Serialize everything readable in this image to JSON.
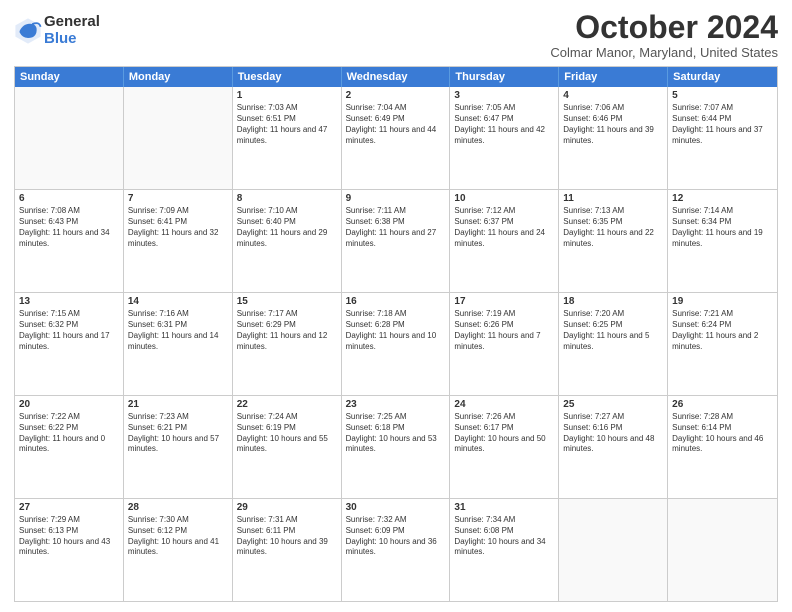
{
  "logo": {
    "general": "General",
    "blue": "Blue"
  },
  "title": "October 2024",
  "location": "Colmar Manor, Maryland, United States",
  "header_days": [
    "Sunday",
    "Monday",
    "Tuesday",
    "Wednesday",
    "Thursday",
    "Friday",
    "Saturday"
  ],
  "rows": [
    [
      {
        "day": "",
        "empty": true,
        "sunrise": "",
        "sunset": "",
        "daylight": ""
      },
      {
        "day": "",
        "empty": true,
        "sunrise": "",
        "sunset": "",
        "daylight": ""
      },
      {
        "day": "1",
        "empty": false,
        "sunrise": "Sunrise: 7:03 AM",
        "sunset": "Sunset: 6:51 PM",
        "daylight": "Daylight: 11 hours and 47 minutes."
      },
      {
        "day": "2",
        "empty": false,
        "sunrise": "Sunrise: 7:04 AM",
        "sunset": "Sunset: 6:49 PM",
        "daylight": "Daylight: 11 hours and 44 minutes."
      },
      {
        "day": "3",
        "empty": false,
        "sunrise": "Sunrise: 7:05 AM",
        "sunset": "Sunset: 6:47 PM",
        "daylight": "Daylight: 11 hours and 42 minutes."
      },
      {
        "day": "4",
        "empty": false,
        "sunrise": "Sunrise: 7:06 AM",
        "sunset": "Sunset: 6:46 PM",
        "daylight": "Daylight: 11 hours and 39 minutes."
      },
      {
        "day": "5",
        "empty": false,
        "sunrise": "Sunrise: 7:07 AM",
        "sunset": "Sunset: 6:44 PM",
        "daylight": "Daylight: 11 hours and 37 minutes."
      }
    ],
    [
      {
        "day": "6",
        "empty": false,
        "sunrise": "Sunrise: 7:08 AM",
        "sunset": "Sunset: 6:43 PM",
        "daylight": "Daylight: 11 hours and 34 minutes."
      },
      {
        "day": "7",
        "empty": false,
        "sunrise": "Sunrise: 7:09 AM",
        "sunset": "Sunset: 6:41 PM",
        "daylight": "Daylight: 11 hours and 32 minutes."
      },
      {
        "day": "8",
        "empty": false,
        "sunrise": "Sunrise: 7:10 AM",
        "sunset": "Sunset: 6:40 PM",
        "daylight": "Daylight: 11 hours and 29 minutes."
      },
      {
        "day": "9",
        "empty": false,
        "sunrise": "Sunrise: 7:11 AM",
        "sunset": "Sunset: 6:38 PM",
        "daylight": "Daylight: 11 hours and 27 minutes."
      },
      {
        "day": "10",
        "empty": false,
        "sunrise": "Sunrise: 7:12 AM",
        "sunset": "Sunset: 6:37 PM",
        "daylight": "Daylight: 11 hours and 24 minutes."
      },
      {
        "day": "11",
        "empty": false,
        "sunrise": "Sunrise: 7:13 AM",
        "sunset": "Sunset: 6:35 PM",
        "daylight": "Daylight: 11 hours and 22 minutes."
      },
      {
        "day": "12",
        "empty": false,
        "sunrise": "Sunrise: 7:14 AM",
        "sunset": "Sunset: 6:34 PM",
        "daylight": "Daylight: 11 hours and 19 minutes."
      }
    ],
    [
      {
        "day": "13",
        "empty": false,
        "sunrise": "Sunrise: 7:15 AM",
        "sunset": "Sunset: 6:32 PM",
        "daylight": "Daylight: 11 hours and 17 minutes."
      },
      {
        "day": "14",
        "empty": false,
        "sunrise": "Sunrise: 7:16 AM",
        "sunset": "Sunset: 6:31 PM",
        "daylight": "Daylight: 11 hours and 14 minutes."
      },
      {
        "day": "15",
        "empty": false,
        "sunrise": "Sunrise: 7:17 AM",
        "sunset": "Sunset: 6:29 PM",
        "daylight": "Daylight: 11 hours and 12 minutes."
      },
      {
        "day": "16",
        "empty": false,
        "sunrise": "Sunrise: 7:18 AM",
        "sunset": "Sunset: 6:28 PM",
        "daylight": "Daylight: 11 hours and 10 minutes."
      },
      {
        "day": "17",
        "empty": false,
        "sunrise": "Sunrise: 7:19 AM",
        "sunset": "Sunset: 6:26 PM",
        "daylight": "Daylight: 11 hours and 7 minutes."
      },
      {
        "day": "18",
        "empty": false,
        "sunrise": "Sunrise: 7:20 AM",
        "sunset": "Sunset: 6:25 PM",
        "daylight": "Daylight: 11 hours and 5 minutes."
      },
      {
        "day": "19",
        "empty": false,
        "sunrise": "Sunrise: 7:21 AM",
        "sunset": "Sunset: 6:24 PM",
        "daylight": "Daylight: 11 hours and 2 minutes."
      }
    ],
    [
      {
        "day": "20",
        "empty": false,
        "sunrise": "Sunrise: 7:22 AM",
        "sunset": "Sunset: 6:22 PM",
        "daylight": "Daylight: 11 hours and 0 minutes."
      },
      {
        "day": "21",
        "empty": false,
        "sunrise": "Sunrise: 7:23 AM",
        "sunset": "Sunset: 6:21 PM",
        "daylight": "Daylight: 10 hours and 57 minutes."
      },
      {
        "day": "22",
        "empty": false,
        "sunrise": "Sunrise: 7:24 AM",
        "sunset": "Sunset: 6:19 PM",
        "daylight": "Daylight: 10 hours and 55 minutes."
      },
      {
        "day": "23",
        "empty": false,
        "sunrise": "Sunrise: 7:25 AM",
        "sunset": "Sunset: 6:18 PM",
        "daylight": "Daylight: 10 hours and 53 minutes."
      },
      {
        "day": "24",
        "empty": false,
        "sunrise": "Sunrise: 7:26 AM",
        "sunset": "Sunset: 6:17 PM",
        "daylight": "Daylight: 10 hours and 50 minutes."
      },
      {
        "day": "25",
        "empty": false,
        "sunrise": "Sunrise: 7:27 AM",
        "sunset": "Sunset: 6:16 PM",
        "daylight": "Daylight: 10 hours and 48 minutes."
      },
      {
        "day": "26",
        "empty": false,
        "sunrise": "Sunrise: 7:28 AM",
        "sunset": "Sunset: 6:14 PM",
        "daylight": "Daylight: 10 hours and 46 minutes."
      }
    ],
    [
      {
        "day": "27",
        "empty": false,
        "sunrise": "Sunrise: 7:29 AM",
        "sunset": "Sunset: 6:13 PM",
        "daylight": "Daylight: 10 hours and 43 minutes."
      },
      {
        "day": "28",
        "empty": false,
        "sunrise": "Sunrise: 7:30 AM",
        "sunset": "Sunset: 6:12 PM",
        "daylight": "Daylight: 10 hours and 41 minutes."
      },
      {
        "day": "29",
        "empty": false,
        "sunrise": "Sunrise: 7:31 AM",
        "sunset": "Sunset: 6:11 PM",
        "daylight": "Daylight: 10 hours and 39 minutes."
      },
      {
        "day": "30",
        "empty": false,
        "sunrise": "Sunrise: 7:32 AM",
        "sunset": "Sunset: 6:09 PM",
        "daylight": "Daylight: 10 hours and 36 minutes."
      },
      {
        "day": "31",
        "empty": false,
        "sunrise": "Sunrise: 7:34 AM",
        "sunset": "Sunset: 6:08 PM",
        "daylight": "Daylight: 10 hours and 34 minutes."
      },
      {
        "day": "",
        "empty": true,
        "sunrise": "",
        "sunset": "",
        "daylight": ""
      },
      {
        "day": "",
        "empty": true,
        "sunrise": "",
        "sunset": "",
        "daylight": ""
      }
    ]
  ]
}
